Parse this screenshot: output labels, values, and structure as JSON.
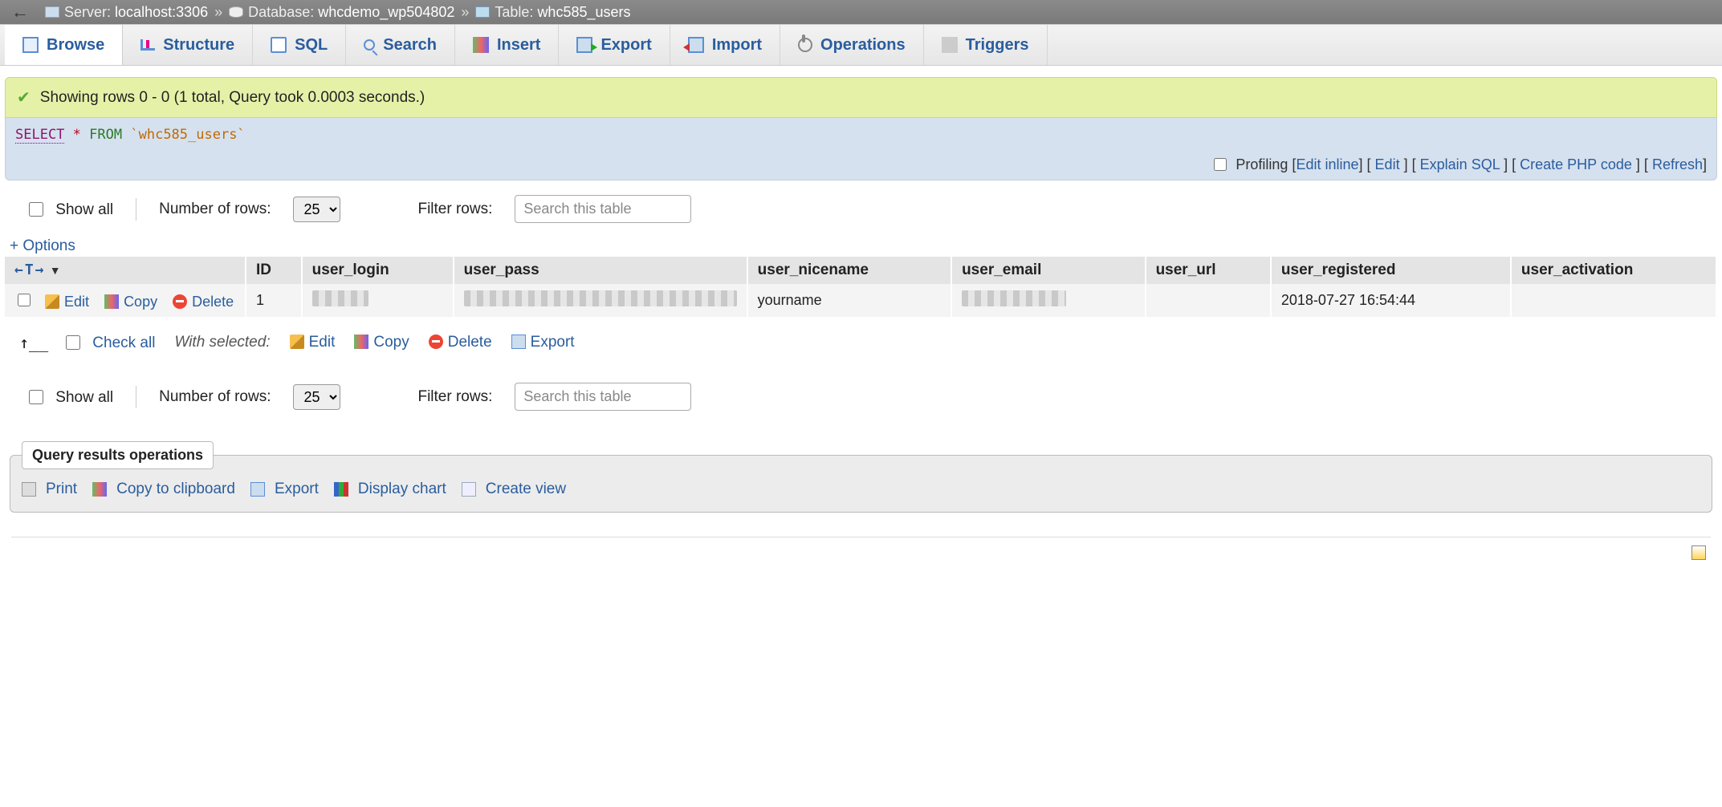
{
  "breadcrumb": {
    "server_label": "Server:",
    "server_value": "localhost:3306",
    "db_label": "Database:",
    "db_value": "whcdemo_wp504802",
    "table_label": "Table:",
    "table_value": "whc585_users"
  },
  "tabs": {
    "browse": "Browse",
    "structure": "Structure",
    "sql": "SQL",
    "search": "Search",
    "insert": "Insert",
    "export": "Export",
    "import": "Import",
    "operations": "Operations",
    "triggers": "Triggers"
  },
  "success_msg": "Showing rows 0 - 0 (1 total, Query took 0.0003 seconds.)",
  "sql": {
    "select": "SELECT",
    "star": "*",
    "from": "FROM",
    "table": "`whc585_users`"
  },
  "sql_actions": {
    "profiling": "Profiling",
    "edit_inline": "Edit inline",
    "edit": "Edit",
    "explain": "Explain SQL",
    "create_php": "Create PHP code",
    "refresh": "Refresh"
  },
  "controls": {
    "show_all": "Show all",
    "num_rows_lbl": "Number of rows:",
    "num_rows": "25",
    "filter_lbl": "Filter rows:",
    "filter_ph": "Search this table"
  },
  "options_link": "+ Options",
  "columns": {
    "id": "ID",
    "user_login": "user_login",
    "user_pass": "user_pass",
    "user_nicename": "user_nicename",
    "user_email": "user_email",
    "user_url": "user_url",
    "user_registered": "user_registered",
    "user_activation": "user_activation"
  },
  "row_actions": {
    "edit": "Edit",
    "copy": "Copy",
    "delete": "Delete"
  },
  "row": {
    "id": "1",
    "user_nicename": "yourname",
    "user_registered": "2018-07-27 16:54:44"
  },
  "bulk": {
    "check_all": "Check all",
    "with_selected": "With selected:",
    "edit": "Edit",
    "copy": "Copy",
    "delete": "Delete",
    "export": "Export"
  },
  "ops_fieldset": {
    "legend": "Query results operations",
    "print": "Print",
    "copy_clip": "Copy to clipboard",
    "export": "Export",
    "chart": "Display chart",
    "create_view": "Create view"
  }
}
